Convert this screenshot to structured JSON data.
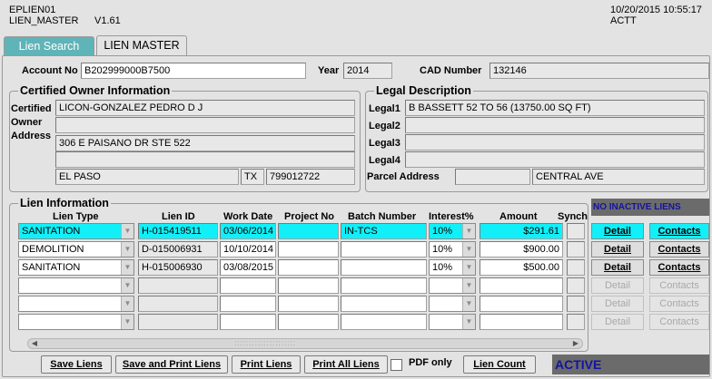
{
  "header": {
    "form_id": "EPLIEN01",
    "form_name": "LIEN_MASTER",
    "version": "V1.61",
    "datetime": "10/20/2015 10:55:17",
    "user": "ACTT"
  },
  "tabs": [
    {
      "label": "Lien Search",
      "active": false
    },
    {
      "label": "LIEN MASTER",
      "active": true
    }
  ],
  "account": {
    "account_label": "Account No",
    "account_value": "B202999000B7500",
    "year_label": "Year",
    "year_value": "2014",
    "cad_label": "CAD Number",
    "cad_value": "132146"
  },
  "owner": {
    "title": "Certified Owner Information",
    "label_certified": "Certified",
    "label_owner": "Owner",
    "label_address": "Address",
    "name": "LICON-GONZALEZ PEDRO D J",
    "name2": "",
    "address1": "306 E PAISANO DR STE 522",
    "address2": "",
    "city": "EL PASO",
    "state": "TX",
    "zip": "799012722"
  },
  "legal": {
    "title": "Legal Description",
    "legal1_label": "Legal1",
    "legal2_label": "Legal2",
    "legal3_label": "Legal3",
    "legal4_label": "Legal4",
    "legal1": "B BASSETT 52 TO 56 (13750.00 SQ FT)",
    "legal2": "",
    "legal3": "",
    "legal4": "",
    "parcel_label": "Parcel Address",
    "parcel_number": "",
    "parcel_street": "CENTRAL AVE"
  },
  "liens": {
    "title": "Lien Information",
    "columns": {
      "lien_type": "Lien Type",
      "lien_id": "Lien ID",
      "work_date": "Work Date",
      "project_no": "Project No",
      "batch_number": "Batch Number",
      "interest": "Interest%",
      "amount": "Amount",
      "synch": "Synch"
    },
    "rows": [
      {
        "lien_type": "SANITATION",
        "lien_id": "H-015419511",
        "work_date": "03/06/2014",
        "project_no": "",
        "batch_number": "IN-TCS",
        "interest": "10%",
        "amount": "$291.61",
        "selected": true
      },
      {
        "lien_type": "DEMOLITION",
        "lien_id": "D-015006931",
        "work_date": "10/10/2014",
        "project_no": "",
        "batch_number": "",
        "interest": "10%",
        "amount": "$900.00",
        "selected": false
      },
      {
        "lien_type": "SANITATION",
        "lien_id": "H-015006930",
        "work_date": "03/08/2015",
        "project_no": "",
        "batch_number": "",
        "interest": "10%",
        "amount": "$500.00",
        "selected": false
      },
      {
        "lien_type": "",
        "lien_id": "",
        "work_date": "",
        "project_no": "",
        "batch_number": "",
        "interest": "",
        "amount": "",
        "selected": false
      },
      {
        "lien_type": "",
        "lien_id": "",
        "work_date": "",
        "project_no": "",
        "batch_number": "",
        "interest": "",
        "amount": "",
        "selected": false
      },
      {
        "lien_type": "",
        "lien_id": "",
        "work_date": "",
        "project_no": "",
        "batch_number": "",
        "interest": "",
        "amount": "",
        "selected": false
      }
    ],
    "inactive_label": "NO INACTIVE LIENS",
    "detail_label": "Detail",
    "contacts_label": "Contacts"
  },
  "footer": {
    "save_liens": "Save Liens",
    "save_print": "Save and Print Liens",
    "print_liens": "Print Liens",
    "print_all": "Print All Liens",
    "pdf_only": "PDF only",
    "lien_count": "Lien Count",
    "status": "ACTIVE"
  },
  "colors": {
    "selected_row": "#11f0f8",
    "status_panel": "#6b6b6b",
    "status_text": "#1414a0",
    "tab_inactive": "#5fb4b8"
  }
}
